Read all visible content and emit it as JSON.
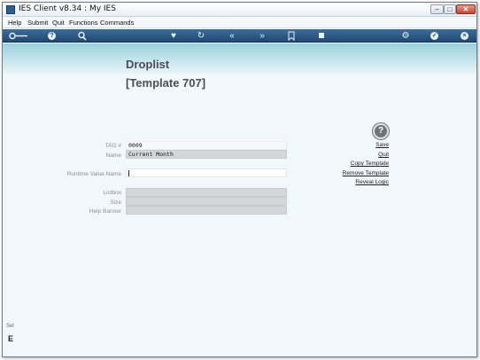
{
  "window": {
    "title": "IES Client v8.34 : My IES",
    "minimize_glyph": "–",
    "maximize_glyph": "□",
    "close_glyph": "✕"
  },
  "menu": {
    "items": [
      "Help",
      "Submit",
      "Quit",
      "Functions",
      "Commands"
    ]
  },
  "toolbar": {
    "icons": [
      "key-icon",
      "help-icon",
      "search-icon",
      "heart-icon",
      "refresh-icon",
      "rewind-icon",
      "fast-forward-icon",
      "bookmark-icon",
      "stop-icon",
      "settings-icon",
      "check-icon",
      "close-icon"
    ]
  },
  "form": {
    "title": "Droplist",
    "subtitle": "[Template 707]",
    "fields": {
      "tag_label": "TAG #",
      "tag_value": "0009",
      "name_label": "Name",
      "name_value": "Current Month",
      "runtime_label": "Runtime Value Name",
      "runtime_value": "",
      "listbox_label": "Listbox",
      "size_label": "Size",
      "help_banner_label": "Help Banner"
    }
  },
  "actions": {
    "help_glyph": "?",
    "save": "Save",
    "quit": "Quit",
    "copy_template": "Copy Template",
    "remove_template": "Remove Template",
    "reveal_logic": "Reveal Logic"
  },
  "sidebar": {
    "text": "Sel",
    "mark": "E"
  },
  "colors": {
    "toolbar": "#1e4a74",
    "banner": "#9bd0dd",
    "background": "#f1f7fd"
  }
}
